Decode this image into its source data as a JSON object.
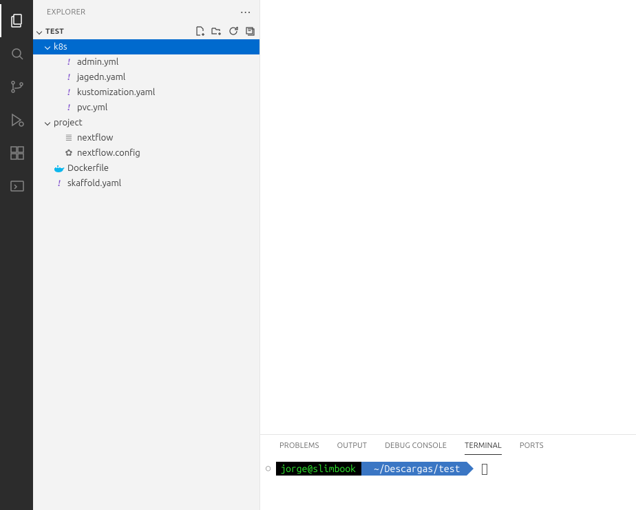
{
  "activity": {
    "items": [
      "explorer",
      "search",
      "source-control",
      "run-debug",
      "extensions",
      "remote"
    ]
  },
  "explorer": {
    "title": "EXPLORER",
    "root_label": "TEST",
    "tree": [
      {
        "kind": "folder",
        "name": "k8s",
        "expanded": true,
        "selected": true,
        "depth": 1
      },
      {
        "kind": "file",
        "name": "admin.yml",
        "icon": "yaml",
        "depth": 2
      },
      {
        "kind": "file",
        "name": "jagedn.yaml",
        "icon": "yaml",
        "depth": 2
      },
      {
        "kind": "file",
        "name": "kustomization.yaml",
        "icon": "yaml",
        "depth": 2
      },
      {
        "kind": "file",
        "name": "pvc.yml",
        "icon": "yaml",
        "depth": 2
      },
      {
        "kind": "folder",
        "name": "project",
        "expanded": true,
        "depth": 1
      },
      {
        "kind": "file",
        "name": "nextflow",
        "icon": "text",
        "depth": 2
      },
      {
        "kind": "file",
        "name": "nextflow.config",
        "icon": "gear",
        "depth": 2
      },
      {
        "kind": "file",
        "name": "Dockerfile",
        "icon": "docker",
        "depth": 1
      },
      {
        "kind": "file",
        "name": "skaffold.yaml",
        "icon": "yaml",
        "depth": 1
      }
    ]
  },
  "panel": {
    "tabs": {
      "problems": "PROBLEMS",
      "output": "OUTPUT",
      "debug_console": "DEBUG CONSOLE",
      "terminal": "TERMINAL",
      "ports": "PORTS"
    },
    "active_tab": "terminal",
    "terminal": {
      "user_host": "jorge@slimbook",
      "cwd": "~/Descargas/test"
    }
  }
}
